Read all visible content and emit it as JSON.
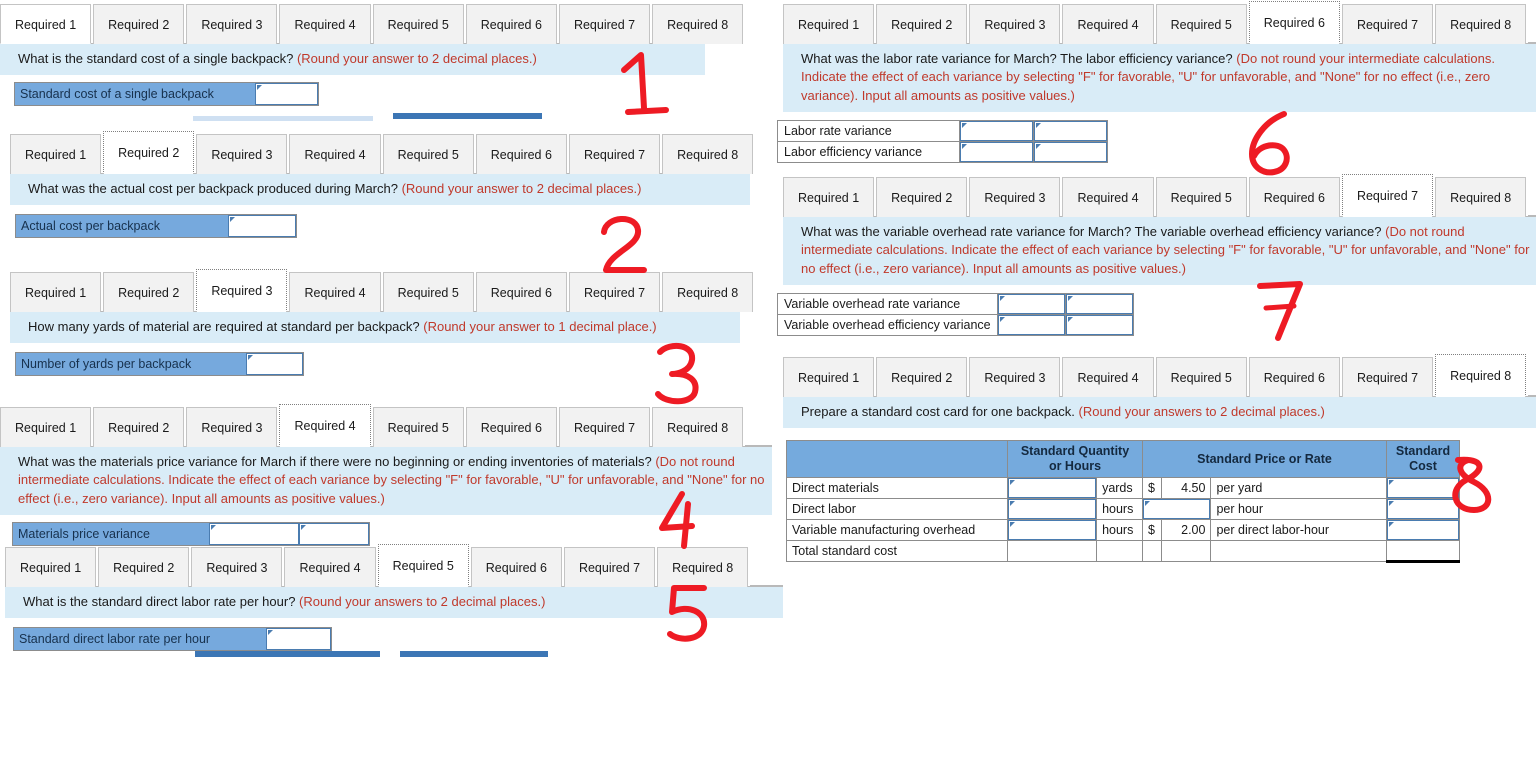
{
  "tab_labels": [
    "Required 1",
    "Required 2",
    "Required 3",
    "Required 4",
    "Required 5",
    "Required 6",
    "Required 7",
    "Required 8"
  ],
  "colors": {
    "banner_bg": "#d9ecf7",
    "note_red": "#c0392b",
    "label_blue": "#76a9dd",
    "header_blue": "#75aadd",
    "input_border": "#4a7cb0",
    "marker_red": "#ee1b24",
    "tab_inactive": "#f2f2f2"
  },
  "panels": [
    {
      "id": "required-1",
      "active_tab": 0,
      "marker": "1",
      "question": "What is the standard cost of a single backpack? ",
      "note": "(Round your answer to 2 decimal places.)",
      "answer_rows": [
        {
          "label": "Standard cost of a single backpack",
          "inputs": 1
        }
      ]
    },
    {
      "id": "required-2",
      "active_tab": 1,
      "marker": "2",
      "question": "What was the actual cost per backpack produced during March? ",
      "note": "(Round your answer to 2 decimal places.)",
      "answer_rows": [
        {
          "label": "Actual cost per backpack",
          "inputs": 1
        }
      ]
    },
    {
      "id": "required-3",
      "active_tab": 2,
      "marker": "3",
      "question": "How many yards of material are required at standard per backpack? ",
      "note": "(Round your answer to 1 decimal place.)",
      "answer_rows": [
        {
          "label": "Number of yards per backpack",
          "inputs": 1
        }
      ]
    },
    {
      "id": "required-4",
      "active_tab": 3,
      "marker": "4",
      "question": "What was the materials price variance for March if there were no beginning or ending inventories of materials? ",
      "note": "(Do not round intermediate calculations. Indicate the effect of each variance by selecting \"F\" for favorable, \"U\" for unfavorable, and \"None\" for no effect (i.e., zero variance). Input all amounts as positive values.)",
      "answer_rows": [
        {
          "label": "Materials price variance",
          "inputs": 2
        }
      ]
    },
    {
      "id": "required-5",
      "active_tab": 4,
      "marker": "5",
      "question": "What is the standard direct labor rate per hour? ",
      "note": "(Round your answers to 2 decimal places.)",
      "answer_rows": [
        {
          "label": "Standard direct labor rate per hour",
          "inputs": 1
        }
      ]
    },
    {
      "id": "required-6",
      "active_tab": 5,
      "marker": "6",
      "question": "What was the labor rate variance for March? The labor efficiency variance? ",
      "note": "(Do not round your intermediate calculations. Indicate the effect of each variance by selecting \"F\" for favorable, \"U\" for unfavorable, and \"None\" for no effect (i.e., zero variance). Input all amounts as positive values.)",
      "variance_rows": [
        {
          "label": "Labor rate variance",
          "inputs": 2
        },
        {
          "label": "Labor efficiency variance",
          "inputs": 2
        }
      ]
    },
    {
      "id": "required-7",
      "active_tab": 6,
      "marker": "7",
      "question": "What was the variable overhead rate variance for March? The variable overhead efficiency variance? ",
      "note": "(Do not round intermediate calculations. Indicate the effect of each variance by selecting \"F\" for favorable, \"U\" for unfavorable, and \"None\" for no effect (i.e., zero variance). Input all amounts as positive values.)",
      "variance_rows": [
        {
          "label": "Variable overhead rate variance",
          "inputs": 2
        },
        {
          "label": "Variable overhead efficiency variance",
          "inputs": 2
        }
      ]
    },
    {
      "id": "required-8",
      "active_tab": 7,
      "marker": "8",
      "question": "Prepare a standard cost card for one backpack. ",
      "note": "(Round your answers to 2 decimal places.)",
      "cost_card": {
        "headers": [
          "",
          "Standard Quantity or Hours",
          "Standard Price or Rate",
          "Standard Cost"
        ],
        "rows": [
          {
            "item": "Direct materials",
            "qty": "",
            "unit": "yards",
            "currency": "$",
            "rate": "4.50",
            "rate_input": false,
            "per": "per yard",
            "cost": ""
          },
          {
            "item": "Direct labor",
            "qty": "",
            "unit": "hours",
            "currency": "",
            "rate": "",
            "rate_input": true,
            "per": "per hour",
            "cost": ""
          },
          {
            "item": "Variable manufacturing overhead",
            "qty": "",
            "unit": "hours",
            "currency": "$",
            "rate": "2.00",
            "rate_input": false,
            "per": "per direct labor-hour",
            "cost": ""
          }
        ],
        "total_label": "Total standard cost"
      }
    }
  ]
}
